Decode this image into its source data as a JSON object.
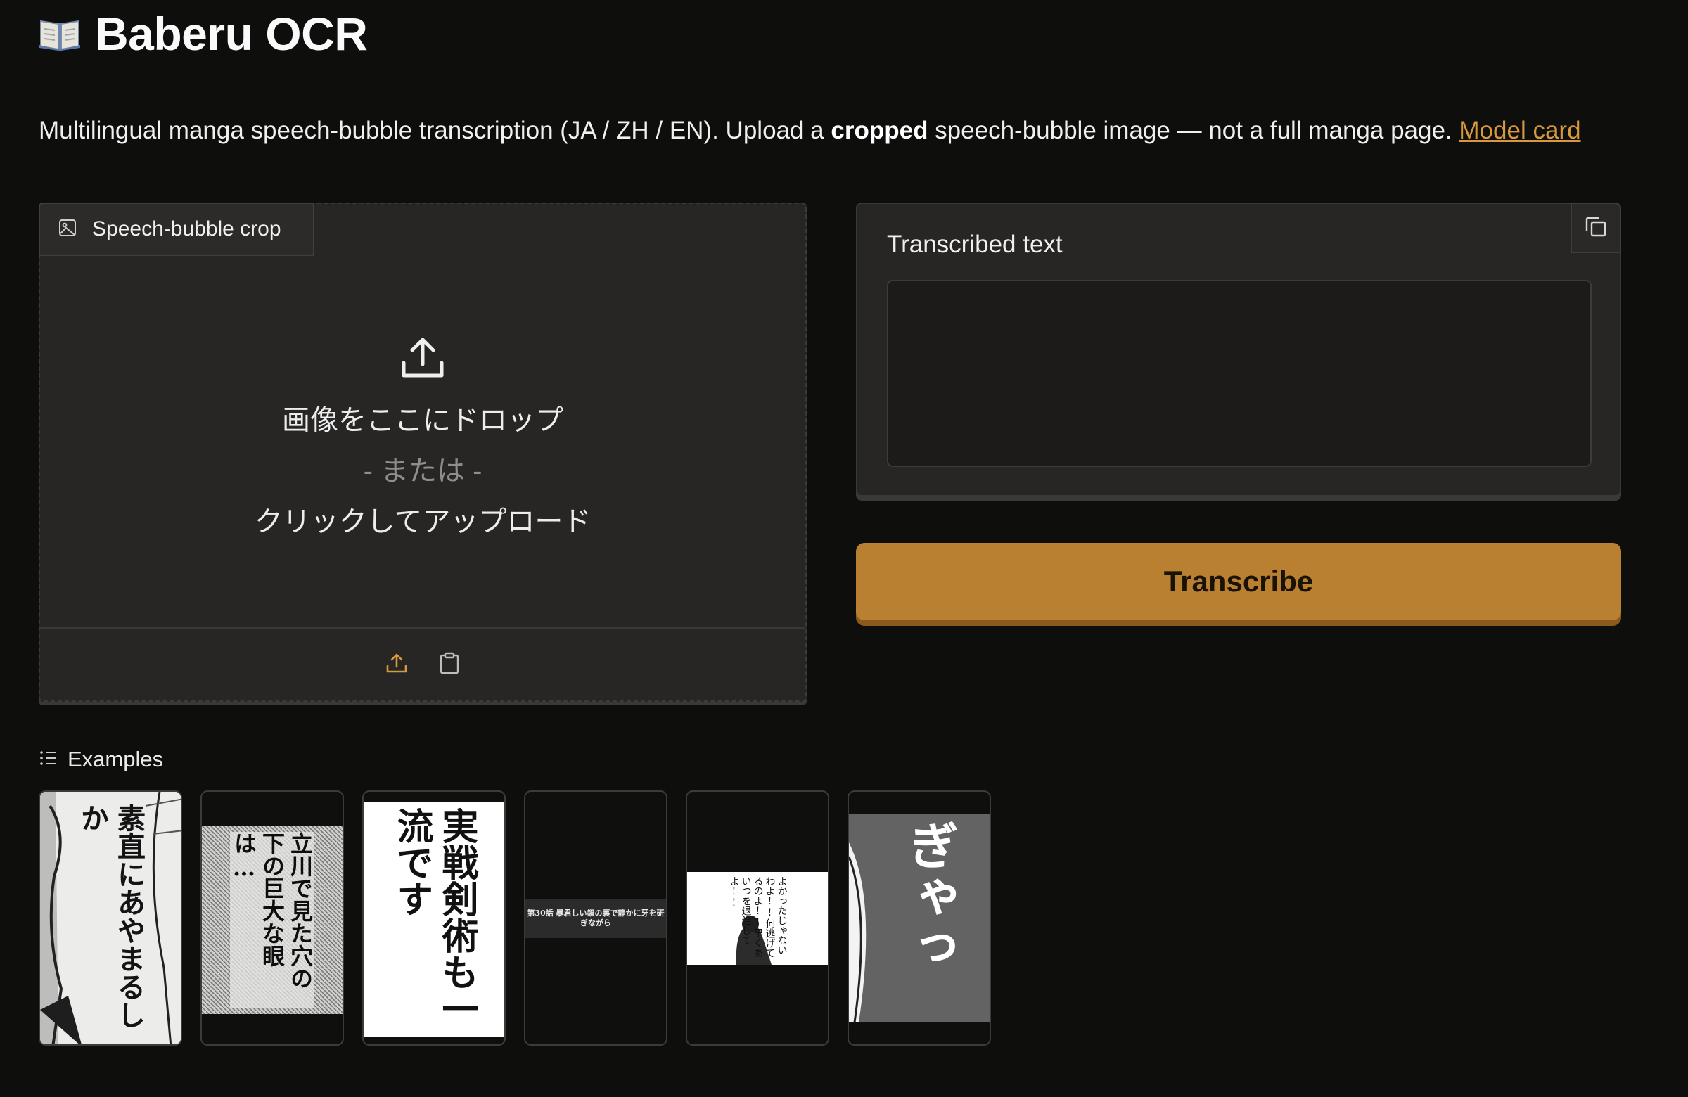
{
  "header": {
    "icon": "book-icon",
    "title": "Baberu OCR"
  },
  "description": {
    "prefix": "Multilingual manga speech-bubble transcription (JA / ZH / EN). Upload a ",
    "bold": "cropped",
    "suffix": " speech-bubble image — not a full manga page. ",
    "link_text": "Model card",
    "link_color": "#d7983e"
  },
  "upload": {
    "tab_label": "Speech-bubble crop",
    "drop_text": "画像をここにドロップ",
    "or_text": "- または -",
    "click_text": "クリックしてアップロード",
    "footer_icons": [
      "upload-icon",
      "clipboard-icon"
    ]
  },
  "output": {
    "label": "Transcribed text",
    "value": "",
    "copy_icon": "copy-icon"
  },
  "transcribe": {
    "label": "Transcribe",
    "color": "#ba8031"
  },
  "examples": {
    "label": "Examples",
    "items": [
      {
        "text": "素直にあやまるしか"
      },
      {
        "text": "立川で見た穴の下の巨大な眼は…"
      },
      {
        "text": "実戦剣術も一流です"
      },
      {
        "text": "第30話 暴君しい鎖の裏で静かに牙を研ぎながら"
      },
      {
        "text": "よかったじゃないわよ!!何逃げてるのよ!!早くあいつを退治してよ!!"
      },
      {
        "text": "ぎゃっ"
      }
    ]
  }
}
